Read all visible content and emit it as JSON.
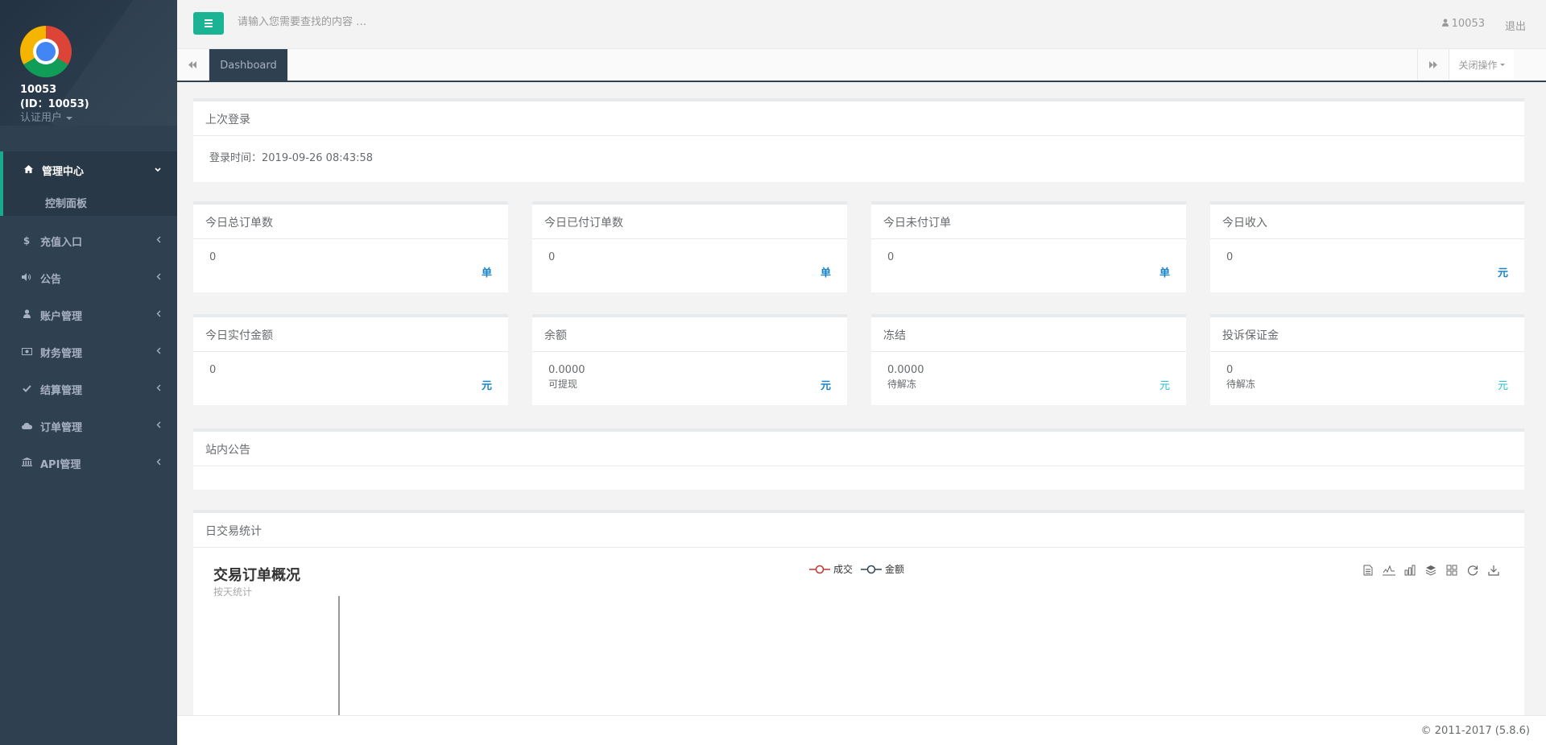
{
  "sidebar": {
    "user_name": "10053",
    "user_id": "(ID：10053)",
    "user_role": "认证用户",
    "menu": {
      "management_center": "管理中心",
      "control_panel": "控制面板",
      "recharge": "充值入口",
      "announcement": "公告",
      "account": "账户管理",
      "finance": "财务管理",
      "settlement": "结算管理",
      "orders": "订单管理",
      "api": "API管理"
    }
  },
  "topbar": {
    "search_placeholder": "请输入您需要查找的内容 …",
    "username": "10053",
    "logout": "退出"
  },
  "tabs": {
    "active_tab": "Dashboard",
    "close_ops": "关闭操作"
  },
  "last_login": {
    "title": "上次登录",
    "text": "登录时间：2019-09-26 08:43:58"
  },
  "stats_row1": [
    {
      "title": "今日总订单数",
      "value": "0",
      "unit": "单"
    },
    {
      "title": "今日已付订单数",
      "value": "0",
      "unit": "单"
    },
    {
      "title": "今日未付订单",
      "value": "0",
      "unit": "单"
    },
    {
      "title": "今日收入",
      "value": "0",
      "unit": "元"
    }
  ],
  "stats_row2": [
    {
      "title": "今日实付金额",
      "value": "0",
      "unit": "元"
    },
    {
      "title": "余额",
      "value": "0.0000",
      "sub": "可提现",
      "unit": "元"
    },
    {
      "title": "冻结",
      "value": "0.0000",
      "sub": "待解冻",
      "unit": "元"
    },
    {
      "title": "投诉保证金",
      "value": "0",
      "sub": "待解冻",
      "unit": "元"
    }
  ],
  "notice": {
    "title": "站内公告"
  },
  "daily_stats": {
    "title": "日交易统计",
    "chart_title": "交易订单概况",
    "chart_subtitle": "按天统计",
    "legend_deal": "成交",
    "legend_amount": "金额"
  },
  "colors": {
    "sidebar_bg": "#2f4050",
    "accent_green": "#1ab394",
    "unit_blue": "#1c84c6",
    "unit_teal": "#23c6c8",
    "legend_deal": "#c23531",
    "legend_amount": "#2f4554"
  },
  "footer": {
    "copyright": "© 2011-2017 (5.8.6)"
  }
}
